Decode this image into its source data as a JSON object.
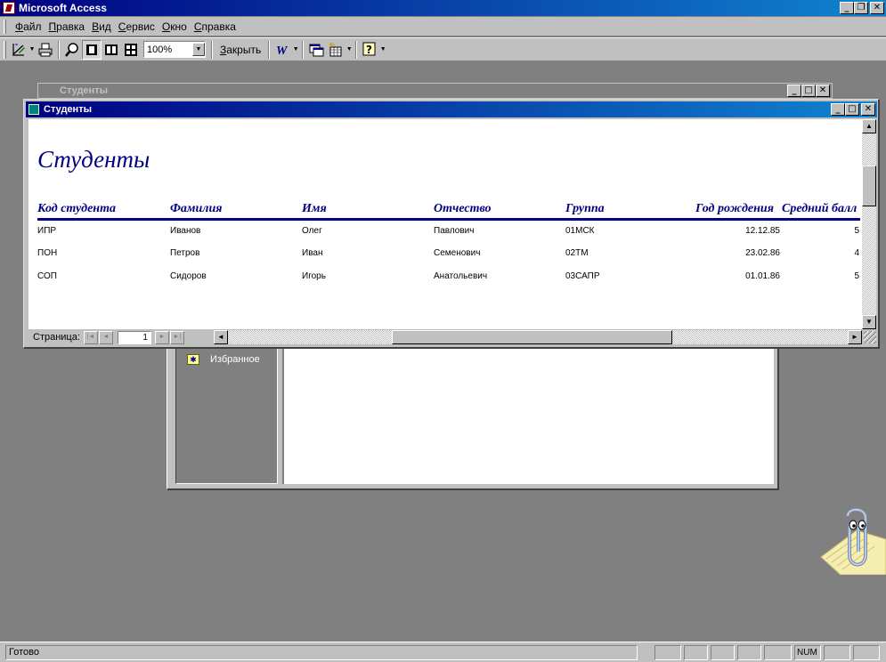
{
  "app": {
    "title": "Microsoft Access"
  },
  "menu": [
    {
      "label": "Файл",
      "access": "Ф",
      "rest": "айл"
    },
    {
      "label": "Правка",
      "access": "П",
      "rest": "равка"
    },
    {
      "label": "Вид",
      "access": "В",
      "rest": "ид"
    },
    {
      "label": "Сервис",
      "access": "С",
      "rest": "ервис"
    },
    {
      "label": "Окно",
      "access": "О",
      "rest": "кно"
    },
    {
      "label": "Справка",
      "access": "С",
      "rest": "правка"
    }
  ],
  "toolbar": {
    "zoom_value": "100%",
    "close_label": "Закрыть",
    "close_access": "З",
    "close_rest": "акрыть",
    "icons": [
      "design-view-icon",
      "print-icon",
      "zoom-icon",
      "one-page-icon",
      "two-pages-icon",
      "multiple-pages-icon",
      "office-links-icon",
      "database-window-icon",
      "new-object-icon",
      "help-icon"
    ]
  },
  "background_window": {
    "title": "Студенты",
    "favorites_label": "Избранное"
  },
  "report_window": {
    "title": "Студенты",
    "heading": "Студенты",
    "columns": [
      "Код студента",
      "Фамилия",
      "Имя",
      "Отчество",
      "Группа",
      "Год рождения",
      "Средний балл"
    ],
    "rows": [
      {
        "code": "ИПР",
        "last": "Иванов",
        "first": "Олег",
        "middle": "Павлович",
        "group": "01МСК",
        "birth": "12.12.85",
        "score": "5"
      },
      {
        "code": "ПОН",
        "last": "Петров",
        "first": "Иван",
        "middle": "Семенович",
        "group": "02ТМ",
        "birth": "23.02.86",
        "score": "4"
      },
      {
        "code": "СОП",
        "last": "Сидоров",
        "first": "Игорь",
        "middle": "Анатольевич",
        "group": "03САПР",
        "birth": "01.01.86",
        "score": "5"
      }
    ],
    "nav": {
      "label": "Страница:",
      "page": "1"
    }
  },
  "status": {
    "text": "Готово",
    "num": "NUM"
  },
  "colors": {
    "title_active": "#000080",
    "title_gradient_end": "#1084d0",
    "report_text": "#000080",
    "desktop": "#808080",
    "face": "#c0c0c0"
  }
}
